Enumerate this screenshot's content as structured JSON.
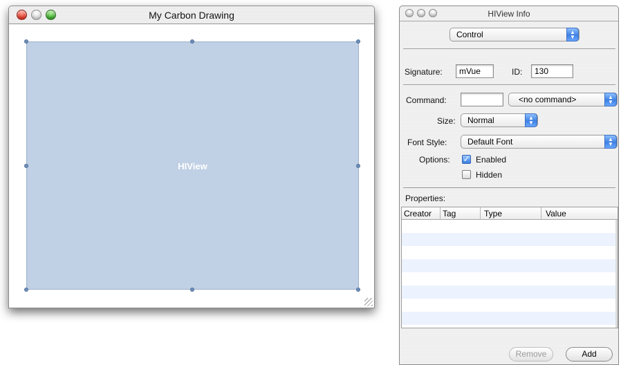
{
  "drawing_window": {
    "title": "My Carbon Drawing",
    "hiview_label": "HIView"
  },
  "info_window": {
    "title": "HIView Info",
    "category_popup": "Control",
    "signature_label": "Signature:",
    "signature_value": "mVue",
    "id_label": "ID:",
    "id_value": "130",
    "command_label": "Command:",
    "command_value": "",
    "command_popup": "<no command>",
    "size_label": "Size:",
    "size_popup": "Normal",
    "font_style_label": "Font Style:",
    "font_style_popup": "Default Font",
    "options_label": "Options:",
    "options": [
      {
        "label": "Enabled",
        "checked": true
      },
      {
        "label": "Hidden",
        "checked": false
      }
    ],
    "properties_label": "Properties:",
    "columns": [
      "Creator",
      "Tag",
      "Type",
      "Value"
    ],
    "remove_button": "Remove",
    "add_button": "Add"
  }
}
